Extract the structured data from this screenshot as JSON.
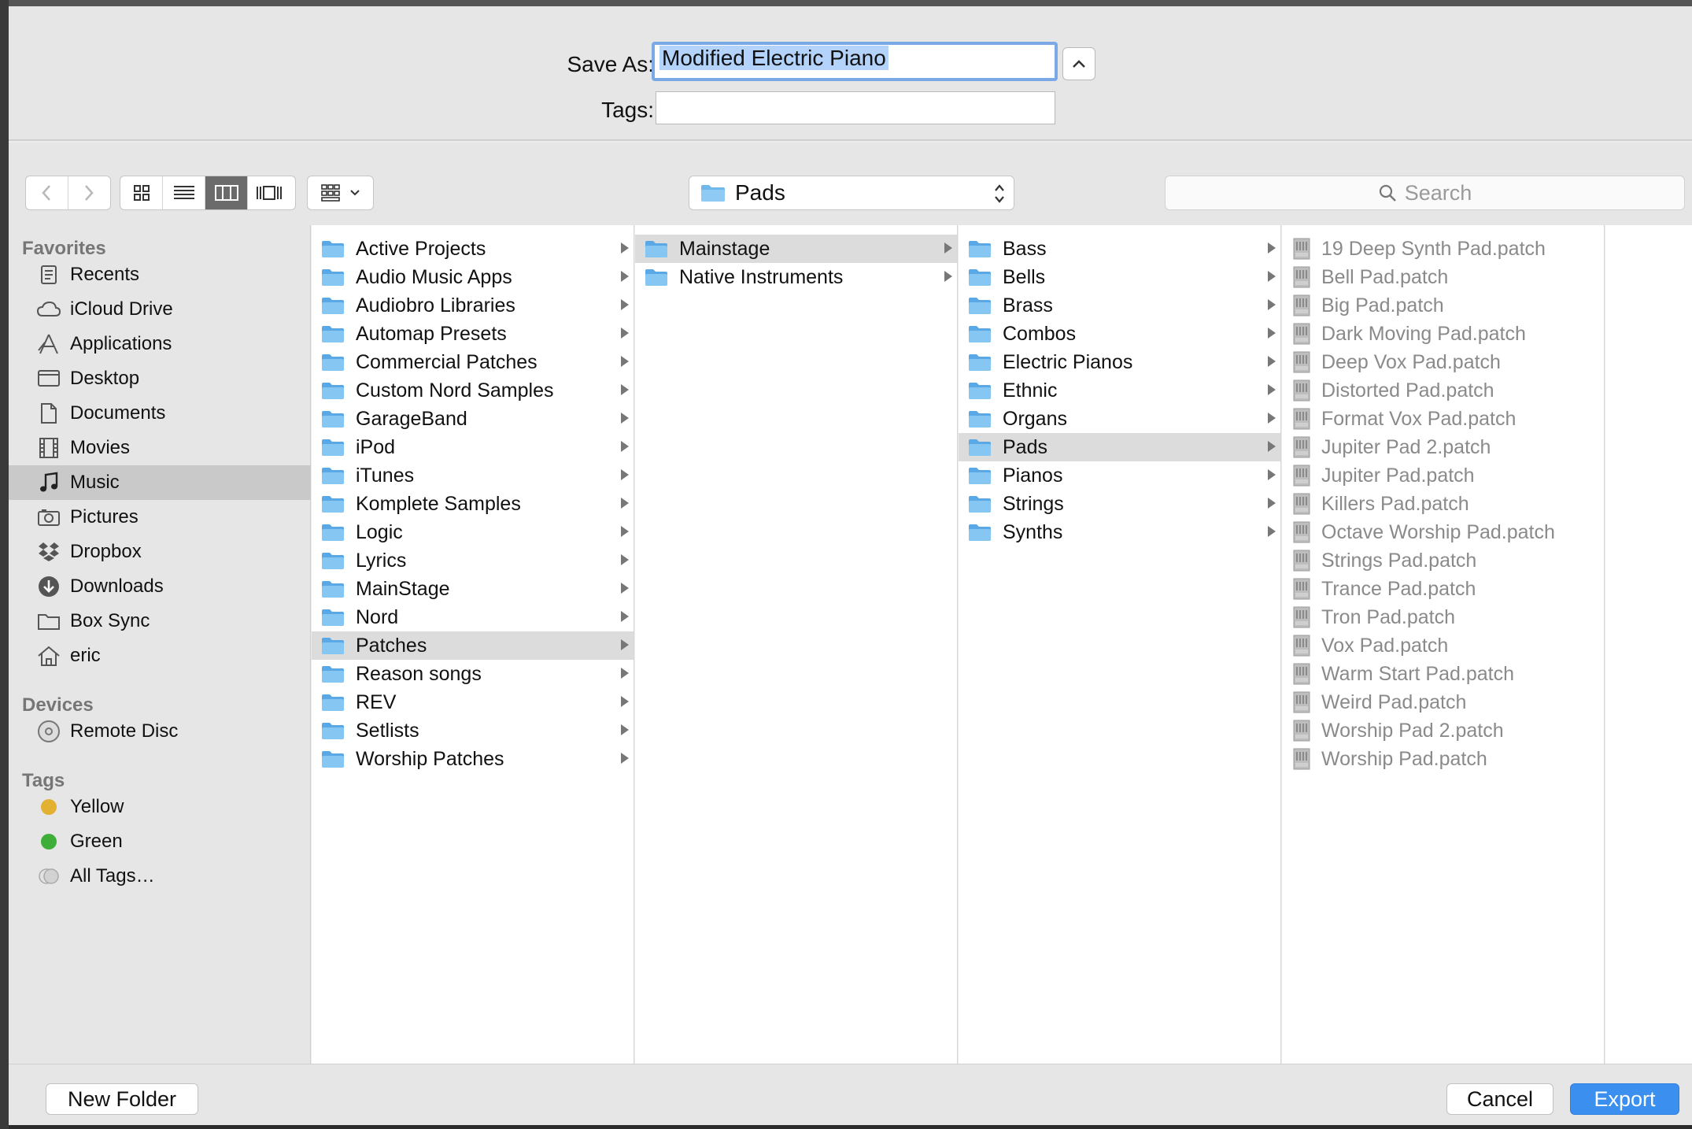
{
  "header": {
    "save_as_label": "Save As:",
    "save_as_value": "Modified Electric Piano",
    "tags_label": "Tags:",
    "tags_value": ""
  },
  "toolbar": {
    "path_popup": "Pads",
    "search_placeholder": "Search"
  },
  "sidebar": {
    "favorites_heading": "Favorites",
    "favorites": [
      {
        "label": "Recents",
        "icon": "recents-icon"
      },
      {
        "label": "iCloud Drive",
        "icon": "cloud-icon"
      },
      {
        "label": "Applications",
        "icon": "applications-icon"
      },
      {
        "label": "Desktop",
        "icon": "desktop-icon"
      },
      {
        "label": "Documents",
        "icon": "documents-icon"
      },
      {
        "label": "Movies",
        "icon": "film-icon"
      },
      {
        "label": "Music",
        "icon": "music-note-icon"
      },
      {
        "label": "Pictures",
        "icon": "camera-icon"
      },
      {
        "label": "Dropbox",
        "icon": "dropbox-icon"
      },
      {
        "label": "Downloads",
        "icon": "download-icon"
      },
      {
        "label": "Box Sync",
        "icon": "folder-icon"
      },
      {
        "label": "eric",
        "icon": "home-icon"
      }
    ],
    "devices_heading": "Devices",
    "devices": [
      {
        "label": "Remote Disc",
        "icon": "disc-icon"
      }
    ],
    "tags_heading": "Tags",
    "tags": [
      {
        "label": "Yellow",
        "color": "#e3b130"
      },
      {
        "label": "Green",
        "color": "#3fae38"
      },
      {
        "label": "All Tags…",
        "color": "#c8c8c8"
      }
    ]
  },
  "columns": {
    "col1": [
      "Active Projects",
      "Audio Music Apps",
      "Audiobro Libraries",
      "Automap Presets",
      "Commercial Patches",
      "Custom Nord Samples",
      "GarageBand",
      "iPod",
      "iTunes",
      "Komplete Samples",
      "Logic",
      "Lyrics",
      "MainStage",
      "Nord",
      "Patches",
      "Reason songs",
      "REV",
      "Setlists",
      "Worship Patches"
    ],
    "col2": [
      "Mainstage",
      "Native Instruments"
    ],
    "col3": [
      "Bass",
      "Bells",
      "Brass",
      "Combos",
      "Electric Pianos",
      "Ethnic",
      "Organs",
      "Pads",
      "Pianos",
      "Strings",
      "Synths"
    ],
    "col4": [
      "19 Deep Synth Pad.patch",
      "Bell Pad.patch",
      "Big Pad.patch",
      "Dark Moving Pad.patch",
      "Deep Vox Pad.patch",
      "Distorted Pad.patch",
      "Format Vox Pad.patch",
      "Jupiter Pad 2.patch",
      "Jupiter Pad.patch",
      "Killers Pad.patch",
      "Octave Worship Pad.patch",
      "Strings Pad.patch",
      "Trance Pad.patch",
      "Tron Pad.patch",
      "Vox Pad.patch",
      "Warm Start Pad.patch",
      "Weird Pad.patch",
      "Worship Pad 2.patch",
      "Worship Pad.patch"
    ]
  },
  "footer": {
    "new_folder": "New Folder",
    "cancel": "Cancel",
    "export": "Export"
  },
  "colors": {
    "folder_blue": "#6fb8ee",
    "accent_blue": "#3a8fef",
    "selection_gray": "#dcdcdc"
  }
}
